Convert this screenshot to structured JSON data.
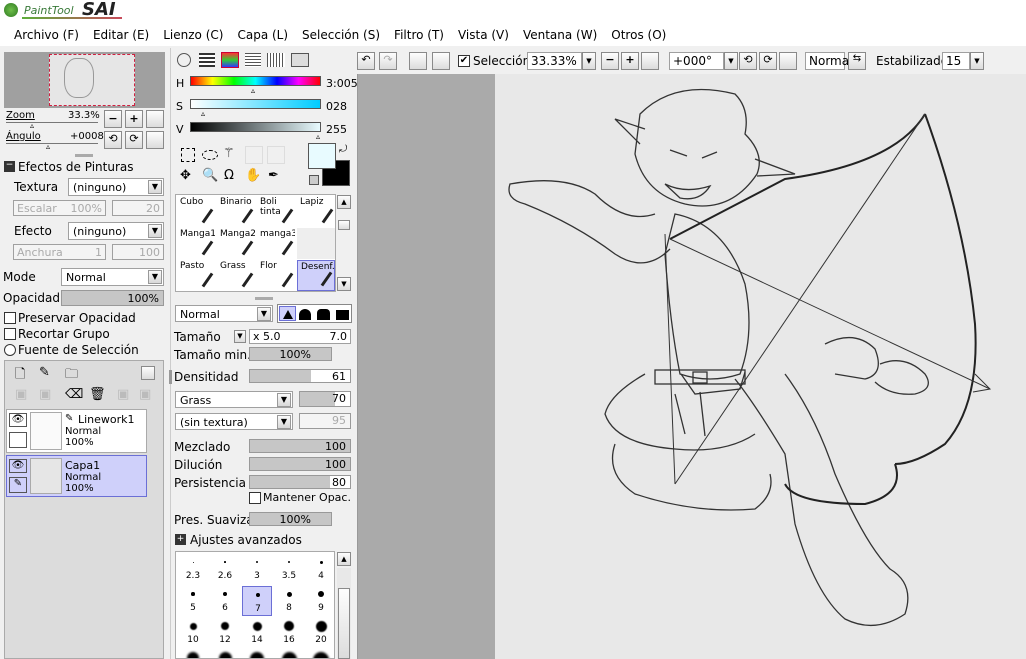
{
  "app": {
    "logo_small": "PaintTool",
    "logo_big": "SAI"
  },
  "menu": [
    "Archivo (F)",
    "Editar (E)",
    "Lienzo (C)",
    "Capa (L)",
    "Selección (S)",
    "Filtro (T)",
    "Vista (V)",
    "Ventana (W)",
    "Otros (O)"
  ],
  "toolbar": {
    "selection_label": "Selección",
    "zoom": "33.33%",
    "angle": "+000°",
    "blend": "Normal",
    "stabilizer_label": "Estabilizador",
    "stabilizer_value": "15"
  },
  "navigator": {
    "zoom_label": "Zoom",
    "zoom_value": "33.3%",
    "angle_label": "Ángulo",
    "angle_value": "+0008"
  },
  "effects": {
    "title": "Efectos de Pinturas",
    "texture_label": "Textura",
    "texture_value": "(ninguno)",
    "scale_label": "Escalar",
    "scale_value": "100%",
    "scale_num": "20",
    "effect_label": "Efecto",
    "effect_value": "(ninguno)",
    "width_label": "Anchura",
    "width_num1": "1",
    "width_num2": "100"
  },
  "layer_opts": {
    "mode_label": "Mode",
    "mode_value": "Normal",
    "opacity_label": "Opacidad",
    "opacity_value": "100%",
    "opacity": 1.0,
    "preserve": "Preservar Opacidad",
    "clip": "Recortar Grupo",
    "source": "Fuente de Selección"
  },
  "layers": [
    {
      "name": "Linework1",
      "mode": "Normal",
      "opacity": "100%"
    },
    {
      "name": "Capa1",
      "mode": "Normal",
      "opacity": "100%"
    }
  ],
  "color": {
    "h_label": "H",
    "h_value": "3:005",
    "s_label": "S",
    "s_value": "028",
    "v_label": "V",
    "v_value": "255",
    "fg": "#e8fbff",
    "bg": "#000000"
  },
  "brushes": [
    [
      "Cubo",
      "Binario",
      "Boli tinta",
      "Lapiz"
    ],
    [
      "Manga1",
      "Manga2",
      "manga3",
      ""
    ],
    [
      "Pasto",
      "Grass",
      "Flor",
      "Desenf."
    ]
  ],
  "brush": {
    "blend": "Normal",
    "size_label": "Tamaño",
    "size_mult": "x 5.0",
    "size_value": "7.0",
    "min_size_label": "Tamaño min.",
    "min_size_value": "100%",
    "min_size": 1.0,
    "density_label": "Densitidad",
    "density_value": "61",
    "density": 0.61,
    "shape": "Grass",
    "shape_value": "70",
    "shape_level": 0.7,
    "texture": "(sin textura)",
    "texture_value": "95",
    "blend_label": "Mezclado",
    "blend_value": "100",
    "blend_level": 1.0,
    "dilution_label": "Dilución",
    "dilution_value": "100",
    "dilution_level": 1.0,
    "persist_label": "Persistencia",
    "persist_value": "80",
    "persist_level": 0.8,
    "keep_opacity": "Mantener Opac.",
    "smooth_label": "Pres. Suavizado",
    "smooth_value": "100%",
    "smooth_level": 1.0,
    "advanced": "Ajustes avanzados"
  },
  "sizes": [
    "2.3",
    "2.6",
    "3",
    "3.5",
    "4",
    "5",
    "6",
    "7",
    "8",
    "9",
    "10",
    "12",
    "14",
    "16",
    "20"
  ]
}
